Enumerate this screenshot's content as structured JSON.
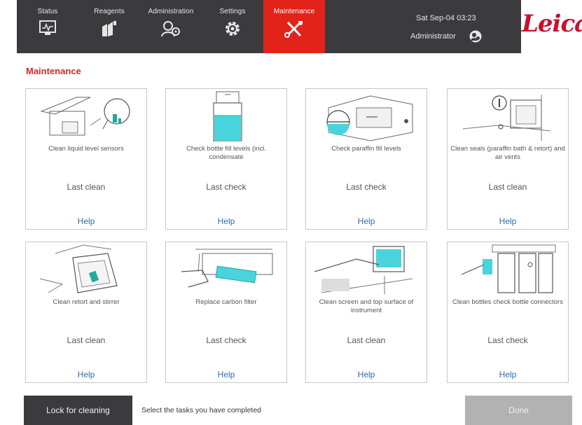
{
  "nav": {
    "tabs": [
      {
        "label": "Status",
        "icon": "status-monitor-icon"
      },
      {
        "label": "Reagents",
        "icon": "reagents-bottles-icon"
      },
      {
        "label": "Administration",
        "icon": "administration-icon"
      },
      {
        "label": "Settings",
        "icon": "settings-gear-icon"
      },
      {
        "label": "Maintenance",
        "icon": "maintenance-tools-icon",
        "active": true
      }
    ],
    "datetime": "Sat Sep-04 03:23",
    "user": "Administrator",
    "logo": "Leica"
  },
  "colors": {
    "accent": "#e2231a",
    "topbar": "#3b3b3d",
    "link": "#2e6db4",
    "title": "#d42a2a"
  },
  "page": {
    "title": "Maintenance"
  },
  "cards": [
    {
      "task": "Clean liquid level sensors",
      "status": "Last clean",
      "help": "Help",
      "icon": "liquid-level-sensor-icon"
    },
    {
      "task": "Check bottle fill levels (incl. condensate",
      "status": "Last check",
      "help": "Help",
      "icon": "bottle-fill-icon"
    },
    {
      "task": "Check paraffin fill levels",
      "status": "Last check",
      "help": "Help",
      "icon": "paraffin-fill-icon"
    },
    {
      "task": "Clean seals (paraffin bath & retort) and air vents",
      "status": "Last clean",
      "help": "Help",
      "icon": "seals-vents-icon"
    },
    {
      "task": "Clean retort and stirrer",
      "status": "Last clean",
      "help": "Help",
      "icon": "retort-stirrer-icon"
    },
    {
      "task": "Replace carbon filter",
      "status": "Last check",
      "help": "Help",
      "icon": "carbon-filter-icon"
    },
    {
      "task": "Clean screen and top surface of instrument",
      "status": "Last clean",
      "help": "Help",
      "icon": "screen-surface-icon"
    },
    {
      "task": "Clean bottles check bottle connectors",
      "status": "Last check",
      "help": "Help",
      "icon": "bottle-connectors-icon"
    }
  ],
  "footer": {
    "lock_label": "Lock for cleaning",
    "hint": "Select the tasks you have completed",
    "done_label": "Done"
  }
}
